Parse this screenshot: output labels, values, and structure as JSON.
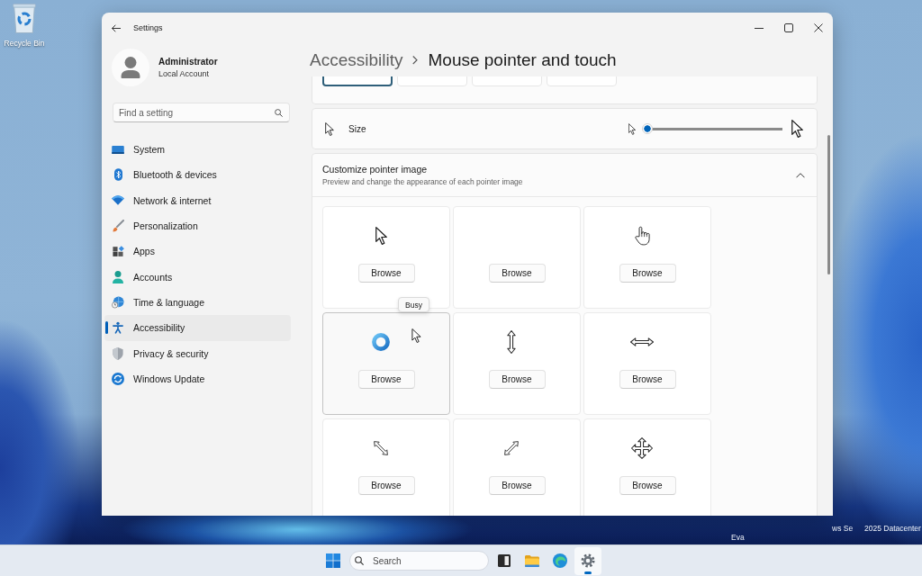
{
  "desktop": {
    "shortcuts": [
      {
        "label": "Recycle Bin"
      }
    ],
    "corner_texts": [
      "ws Se",
      "2025 Datacenter",
      "Eva"
    ]
  },
  "window": {
    "title": "Settings",
    "account": {
      "name": "Administrator",
      "type": "Local Account"
    },
    "search": {
      "placeholder": "Find a setting"
    },
    "nav_items": [
      {
        "label": "System",
        "selected": false
      },
      {
        "label": "Bluetooth & devices",
        "selected": false
      },
      {
        "label": "Network & internet",
        "selected": false
      },
      {
        "label": "Personalization",
        "selected": false
      },
      {
        "label": "Apps",
        "selected": false
      },
      {
        "label": "Accounts",
        "selected": false
      },
      {
        "label": "Time & language",
        "selected": false
      },
      {
        "label": "Accessibility",
        "selected": true
      },
      {
        "label": "Privacy & security",
        "selected": false
      },
      {
        "label": "Windows Update",
        "selected": false
      }
    ],
    "breadcrumb": {
      "parent": "Accessibility",
      "current": "Mouse pointer and touch"
    },
    "pointer_style_tiles": [
      {
        "selected": true
      },
      {
        "selected": false
      },
      {
        "selected": false
      },
      {
        "selected": false
      }
    ],
    "size_setting": {
      "label": "Size",
      "level": 0
    },
    "customize_pointer_image": {
      "title": "Customize pointer image",
      "subtitle": "Preview and change the appearance of each pointer image",
      "expanded": true,
      "tiles": [
        {
          "button": "Browse",
          "hovered": false
        },
        {
          "button": "Browse",
          "hovered": false
        },
        {
          "button": "Browse",
          "hovered": false
        },
        {
          "button": "Browse",
          "hovered": true,
          "tooltip": "Busy"
        },
        {
          "button": "Browse",
          "hovered": false
        },
        {
          "button": "Browse",
          "hovered": false
        },
        {
          "button": "Browse",
          "hovered": false
        },
        {
          "button": "Browse",
          "hovered": false
        },
        {
          "button": "Browse",
          "hovered": false
        }
      ]
    }
  },
  "taskbar": {
    "search": {
      "placeholder": "Search"
    },
    "apps": [
      {
        "active": false
      },
      {
        "active": false
      },
      {
        "active": false
      },
      {
        "active": true
      }
    ]
  }
}
